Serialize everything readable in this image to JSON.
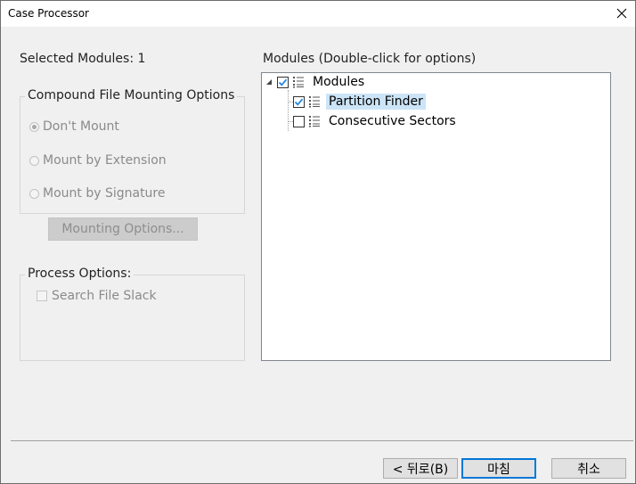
{
  "window": {
    "title": "Case Processor"
  },
  "left": {
    "selected_label": "Selected Modules:",
    "selected_count": "1",
    "mount_group": {
      "legend": "Compound File Mounting Options",
      "options": [
        {
          "label": "Don't Mount",
          "checked": true
        },
        {
          "label": "Mount by Extension",
          "checked": false
        },
        {
          "label": "Mount by Signature",
          "checked": false
        }
      ]
    },
    "mounting_options_button": "Mounting Options...",
    "process_group": {
      "legend": "Process Options:",
      "search_slack_label": "Search File Slack"
    }
  },
  "right": {
    "modules_label": "Modules (Double-click for options)",
    "tree": {
      "root": {
        "label": "Modules",
        "checked": true,
        "expanded": true
      },
      "children": [
        {
          "label": "Partition Finder",
          "checked": true,
          "selected": true
        },
        {
          "label": "Consecutive Sectors",
          "checked": false,
          "selected": false
        }
      ]
    }
  },
  "footer": {
    "back_label": "< 뒤로(B)",
    "finish_label": "마침",
    "cancel_label": "취소"
  },
  "colors": {
    "accent": "#0078d7",
    "selection": "#cce4f7",
    "check_mark": "#1e88e5"
  },
  "icons": {
    "close": "close-icon",
    "list": "list-icon",
    "expander": "expander-icon"
  }
}
